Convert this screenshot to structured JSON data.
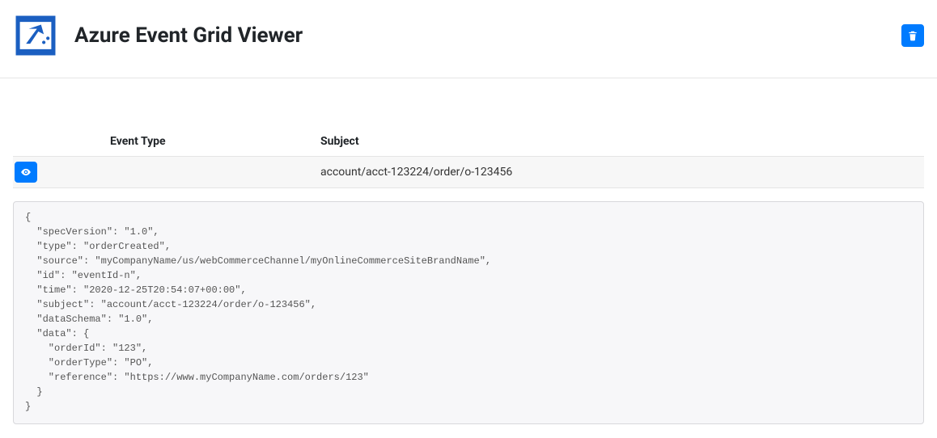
{
  "header": {
    "title": "Azure Event Grid Viewer"
  },
  "actions": {
    "trash_title": "Clear events",
    "view_title": "View event"
  },
  "table": {
    "headers": {
      "event_type": "Event Type",
      "subject": "Subject"
    },
    "rows": [
      {
        "event_type": "",
        "subject": "account/acct-123224/order/o-123456"
      }
    ]
  },
  "detail_json_text": "{\n  \"specVersion\": \"1.0\",\n  \"type\": \"orderCreated\",\n  \"source\": \"myCompanyName/us/webCommerceChannel/myOnlineCommerceSiteBrandName\",\n  \"id\": \"eventId-n\",\n  \"time\": \"2020-12-25T20:54:07+00:00\",\n  \"subject\": \"account/acct-123224/order/o-123456\",\n  \"dataSchema\": \"1.0\",\n  \"data\": {\n    \"orderId\": \"123\",\n    \"orderType\": \"PO\",\n    \"reference\": \"https://www.myCompanyName.com/orders/123\"\n  }\n}"
}
